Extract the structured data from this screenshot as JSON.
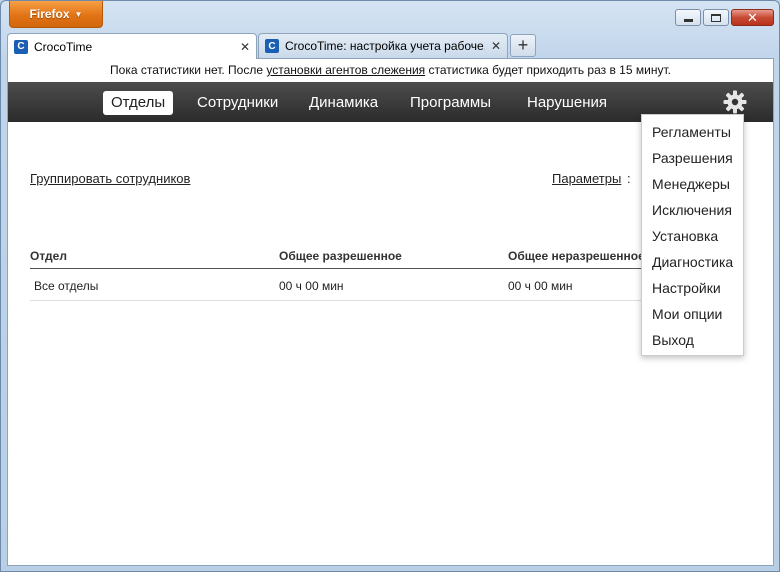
{
  "browser": {
    "menu_button": "Firefox",
    "tabs": [
      {
        "title": "CrocoTime",
        "active": true
      },
      {
        "title": "CrocoTime: настройка учета рабоче...",
        "active": false
      }
    ],
    "new_tab": "+",
    "close_glyph": "✕"
  },
  "page": {
    "notice_before": "Пока статистики нет. После ",
    "notice_link": "установки агентов слежения",
    "notice_after": " статистика будет приходить раз в 15 минут.",
    "nav": [
      "Отделы",
      "Сотрудники",
      "Динамика",
      "Программы",
      "Нарушения"
    ],
    "active_nav": "Отделы",
    "group_link": "Группировать сотрудников",
    "params_link": "Параметры",
    "params_colon": ":",
    "table": {
      "headers": [
        "Отдел",
        "Общее разрешенное",
        "Общее неразрешенное"
      ],
      "rows": [
        [
          "Все отделы",
          "00 ч 00 мин",
          "00 ч 00 мин"
        ]
      ]
    },
    "settings_menu": [
      "Регламенты",
      "Разрешения",
      "Менеджеры",
      "Исключения",
      "Установка",
      "Диагностика",
      "Настройки",
      "Мои опции",
      "Выход"
    ]
  },
  "colors": {
    "navbar": "#333333",
    "firefox_orange": "#e27415",
    "accent_blue": "#1a5fb4"
  },
  "icons": [
    "firefox-menu-caret-icon",
    "minimize-icon",
    "maximize-icon",
    "close-icon",
    "crocotime-favicon-icon",
    "tab-close-icon",
    "new-tab-icon",
    "gear-icon"
  ]
}
